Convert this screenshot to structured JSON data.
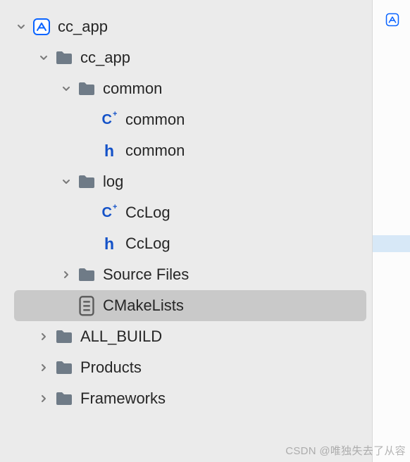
{
  "watermark": "CSDN @唯独失去了从容",
  "tree": {
    "root": {
      "label": "cc_app"
    },
    "target": {
      "label": "cc_app"
    },
    "common_folder": {
      "label": "common"
    },
    "common_cpp": {
      "label": "common"
    },
    "common_h": {
      "label": "common"
    },
    "log_folder": {
      "label": "log"
    },
    "cclog_cpp": {
      "label": "CcLog"
    },
    "cclog_h": {
      "label": "CcLog"
    },
    "source_files": {
      "label": "Source Files"
    },
    "cmakelists": {
      "label": "CMakeLists"
    },
    "all_build": {
      "label": "ALL_BUILD"
    },
    "products": {
      "label": "Products"
    },
    "frameworks": {
      "label": "Frameworks"
    }
  }
}
